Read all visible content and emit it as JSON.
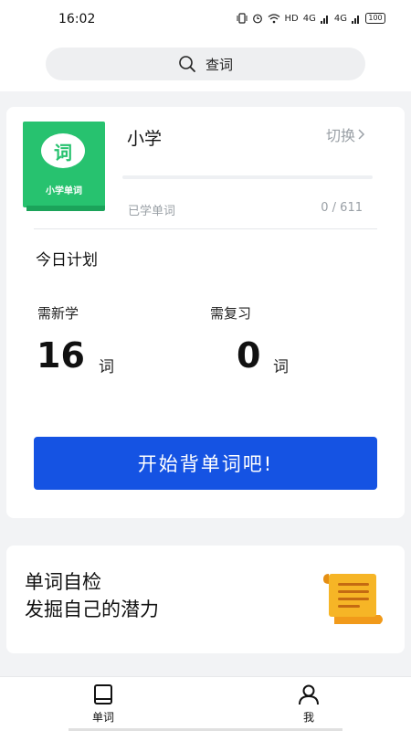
{
  "status_bar": {
    "time": "16:02",
    "network": "HD",
    "signal1": "4G",
    "signal2": "4G",
    "battery": "100"
  },
  "search": {
    "icon": "search-icon",
    "label": "查词"
  },
  "book": {
    "cover_char": "词",
    "cover_title": "小学单词",
    "color": "#27c26f"
  },
  "plan_card": {
    "level": "小学",
    "switch_label": "切换",
    "learned_label": "已学单词",
    "learned_count": "0 / 611",
    "progress_fraction": 0,
    "plan_title": "今日计划",
    "need_new_label": "需新学",
    "need_new_value": "16",
    "need_review_label": "需复习",
    "need_review_value": "0",
    "unit": "词",
    "start_button": "开始背单词吧!",
    "accent_color": "#1553e3"
  },
  "self_check": {
    "title": "单词自检",
    "subtitle": "发掘自己的潜力",
    "icon": "scroll-icon"
  },
  "tabs": [
    {
      "label": "单词",
      "icon": "book-icon"
    },
    {
      "label": "我",
      "icon": "person-icon"
    }
  ]
}
